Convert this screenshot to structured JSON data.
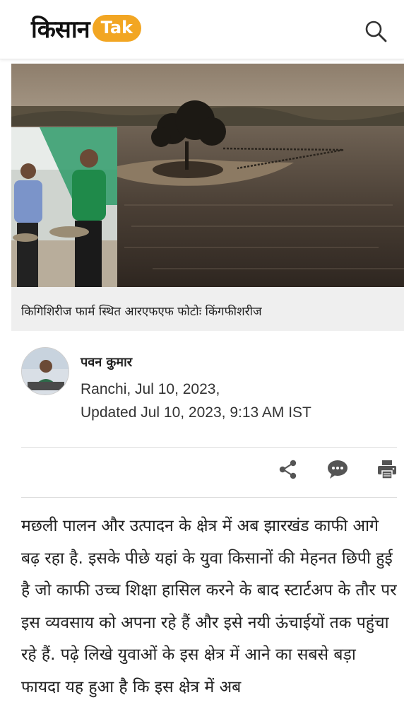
{
  "header": {
    "logo_kisan": "किसान",
    "logo_tak": "Tak",
    "search_icon": "search-icon"
  },
  "hero": {
    "caption": "किगिशिरीज फार्म स्थित आरएफएफ फोटोः किंगफीशरीज"
  },
  "author": {
    "name": "पवन कुमार",
    "dateline": "Ranchi, Jul 10, 2023,",
    "updated": "Updated Jul 10, 2023, 9:13 AM IST"
  },
  "actions": {
    "share_icon": "share-icon",
    "comment_icon": "comment-icon",
    "print_icon": "print-icon"
  },
  "article": {
    "body": "मछली पालन और उत्पादन के क्षेत्र में अब झारखंड काफी आगे बढ़ रहा है. इसके पीछे यहां के युवा किसानों की मेहनत छिपी हुई है जो काफी उच्च शिक्षा हासिल करने के बाद स्टार्टअप के तौर पर इस व्यवसाय को अपना रहे हैं और इसे नयी ऊंचाईयों तक पहुंचा रहे हैं. पढ़े लिखे युवाओं के इस क्षेत्र में आने का सबसे बड़ा फायदा यह हुआ है कि इस क्षेत्र में अब"
  },
  "colors": {
    "brand_orange": "#f2a623",
    "caption_bg": "#efefef",
    "icon_gray": "#555555"
  }
}
